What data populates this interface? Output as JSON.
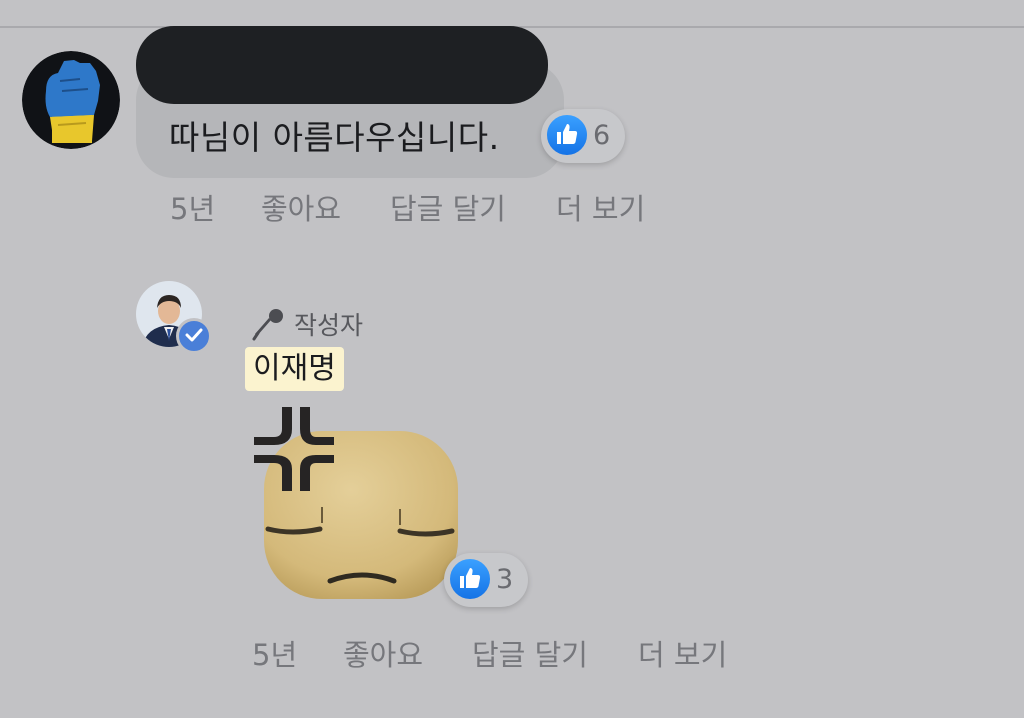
{
  "comments": [
    {
      "text": "따님이 아름다우십니다.",
      "reaction_count": "6",
      "time": "5년",
      "actions": {
        "like": "좋아요",
        "reply": "답글 달기",
        "more": "더 보기"
      }
    },
    {
      "author_badge": "작성자",
      "author_name": "이재명",
      "sticker_icon": "angry-face-sticker",
      "reaction_count": "3",
      "time": "5년",
      "actions": {
        "like": "좋아요",
        "reply": "답글 달기",
        "more": "더 보기"
      }
    }
  ],
  "colors": {
    "background": "#c2c2c5",
    "bubble": "#b5b6b9",
    "like_blue": "#1877f2",
    "name_highlight": "#fbf3cf",
    "verified": "#4a7fd8"
  }
}
